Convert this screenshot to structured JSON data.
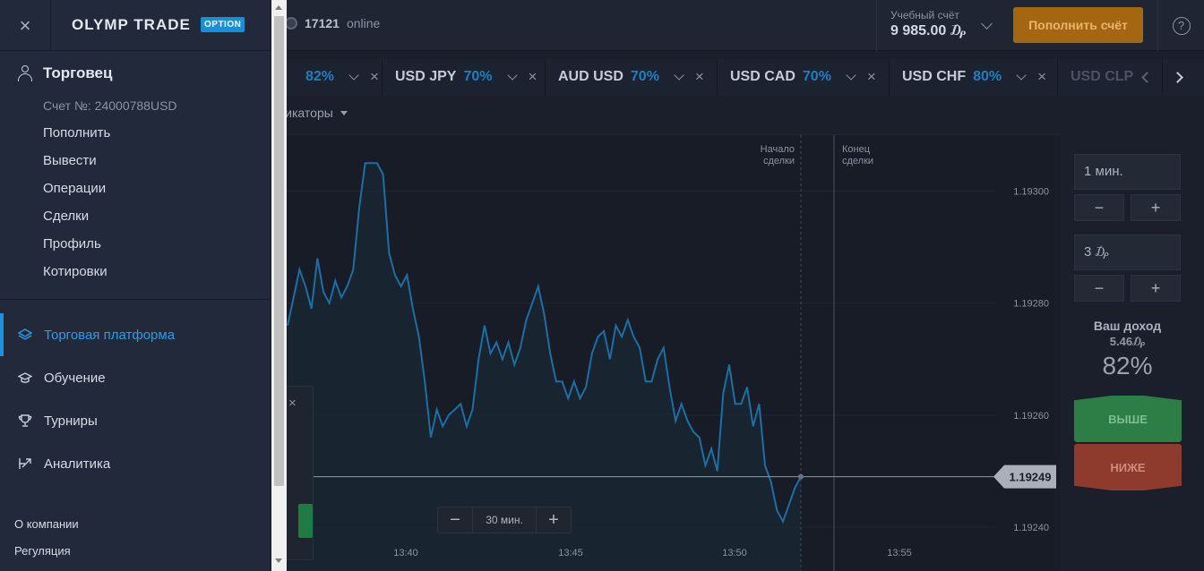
{
  "topbar": {
    "online_count": "17121",
    "online_label": "online",
    "account_label": "Учебный счёт",
    "account_balance": "9 985.00 ₯",
    "deposit_button": "Пополнить счёт",
    "help_icon": "?"
  },
  "sidebar": {
    "logo": "OLYMP TRADE",
    "logo_badge": "OPTION",
    "close_icon": "×",
    "user_name": "Торговец",
    "account_number": "Счет №: 24000788USD",
    "account_menu": [
      "Пополнить",
      "Вывести",
      "Операции",
      "Сделки",
      "Профиль",
      "Котировки"
    ],
    "main_menu": [
      {
        "label": "Торговая платформа",
        "icon": "layers-icon",
        "active": true
      },
      {
        "label": "Обучение",
        "icon": "graduation-cap-icon",
        "active": false
      },
      {
        "label": "Турниры",
        "icon": "trophy-icon",
        "active": false
      },
      {
        "label": "Аналитика",
        "icon": "analytics-icon",
        "active": false
      }
    ],
    "footer": [
      "О компании",
      "Регуляция"
    ]
  },
  "tabs": [
    {
      "name": "",
      "pct": "82%"
    },
    {
      "name": "USD JPY",
      "pct": "70%"
    },
    {
      "name": "AUD USD",
      "pct": "70%"
    },
    {
      "name": "USD CAD",
      "pct": "70%"
    },
    {
      "name": "USD CHF",
      "pct": "80%"
    },
    {
      "name": "USD CLP",
      "pct": ""
    }
  ],
  "indicators_label": "дикаторы",
  "chart": {
    "start_label": [
      "Начало",
      "сделки"
    ],
    "end_label": [
      "Конец",
      "сделки"
    ],
    "zoom_value": "30 мин.",
    "zoom_minus": "−",
    "zoom_plus": "+",
    "mini_close": "×"
  },
  "chart_data": {
    "type": "line",
    "y_ticks": [
      "1.19300",
      "1.19280",
      "1.19260",
      "1.19240"
    ],
    "x_ticks": [
      "13:40",
      "13:45",
      "13:50",
      "13:55"
    ],
    "current_price": "1.19249",
    "ylim": [
      1.19232,
      1.1931
    ],
    "series": [
      {
        "values": [
          1.19276,
          1.19281,
          1.19286,
          1.19283,
          1.19279,
          1.19288,
          1.19282,
          1.1928,
          1.19284,
          1.19281,
          1.19283,
          1.19286,
          1.19297,
          1.19305,
          1.19305,
          1.19305,
          1.19303,
          1.19289,
          1.19285,
          1.19283,
          1.19285,
          1.19279,
          1.19274,
          1.19266,
          1.19256,
          1.19261,
          1.19258,
          1.1926,
          1.19261,
          1.19262,
          1.19258,
          1.19261,
          1.1927,
          1.19276,
          1.19271,
          1.19273,
          1.1927,
          1.19273,
          1.19269,
          1.19272,
          1.19277,
          1.1928,
          1.19283,
          1.19278,
          1.19271,
          1.19266,
          1.19266,
          1.19263,
          1.19266,
          1.19263,
          1.19265,
          1.19271,
          1.19274,
          1.19275,
          1.1927,
          1.19276,
          1.19274,
          1.19277,
          1.19274,
          1.19272,
          1.19266,
          1.19266,
          1.1927,
          1.19272,
          1.19265,
          1.19259,
          1.19262,
          1.19259,
          1.19257,
          1.19256,
          1.19251,
          1.19254,
          1.1925,
          1.19264,
          1.19269,
          1.19262,
          1.19262,
          1.19265,
          1.19258,
          1.19262,
          1.19251,
          1.19248,
          1.19243,
          1.19241,
          1.19244,
          1.19247,
          1.19249
        ]
      }
    ]
  },
  "trade_panel": {
    "time_value": "1 мин.",
    "amount_value": "3 ₯",
    "minus": "−",
    "plus": "+",
    "income_label": "Ваш доход",
    "income_value": "5.46₯",
    "income_pct": "82%",
    "up_button": "ВЫШЕ",
    "down_button": "НИЖЕ"
  },
  "colors": {
    "accent_blue": "#1f8fe0",
    "line_blue": "#1c6fa3",
    "deposit_orange": "#a56611",
    "up_green": "#2c7d46",
    "down_red": "#8e3a2c"
  }
}
